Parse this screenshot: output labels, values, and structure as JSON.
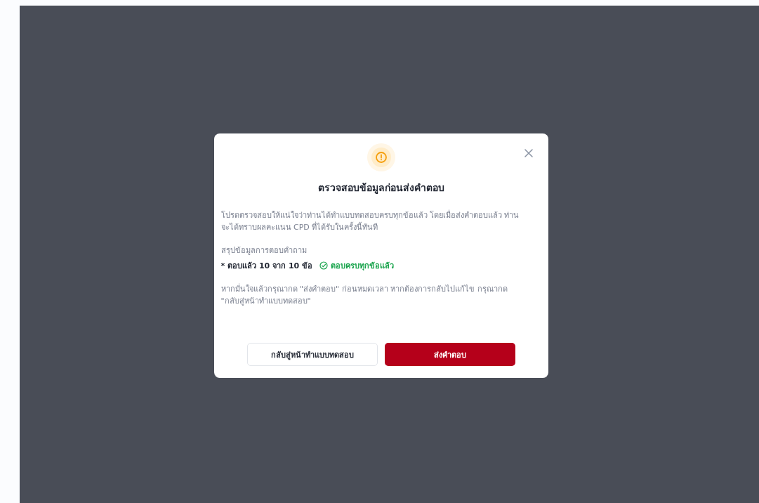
{
  "dialog": {
    "title": "ตรวจสอบข้อมูลก่อนส่งคำตอบ",
    "message": "โปรดตรวจสอบให้แน่ใจว่าท่านได้ทำแบบทดสอบครบทุกข้อแล้ว โดยเมื่อส่งคำตอบแล้ว ท่านจะได้ทราบผลคะแนน CPD ที่ได้รับในครั้งนี้ทันที",
    "summary_label": "สรุปข้อมูลการตอบคำถาม",
    "answered": "* ตอบแล้ว 10 จาก 10 ข้อ",
    "status": {
      "text": "ตอบครบทุกข้อแล้ว",
      "complete": true
    },
    "note": "หากมั่นใจแล้วกรุณากด \"ส่งคำตอบ\" ก่อนหมดเวลา หากต้องการกลับไปแก้ไข กรุณากด \"กลับสู่หน้าทำแบบทดสอบ\"",
    "buttons": [
      {
        "label": "กลับสู่หน้าทำแบบทดสอบ",
        "kind": "secondary"
      },
      {
        "label": "ส่งคำตอบ",
        "kind": "primary"
      }
    ]
  }
}
